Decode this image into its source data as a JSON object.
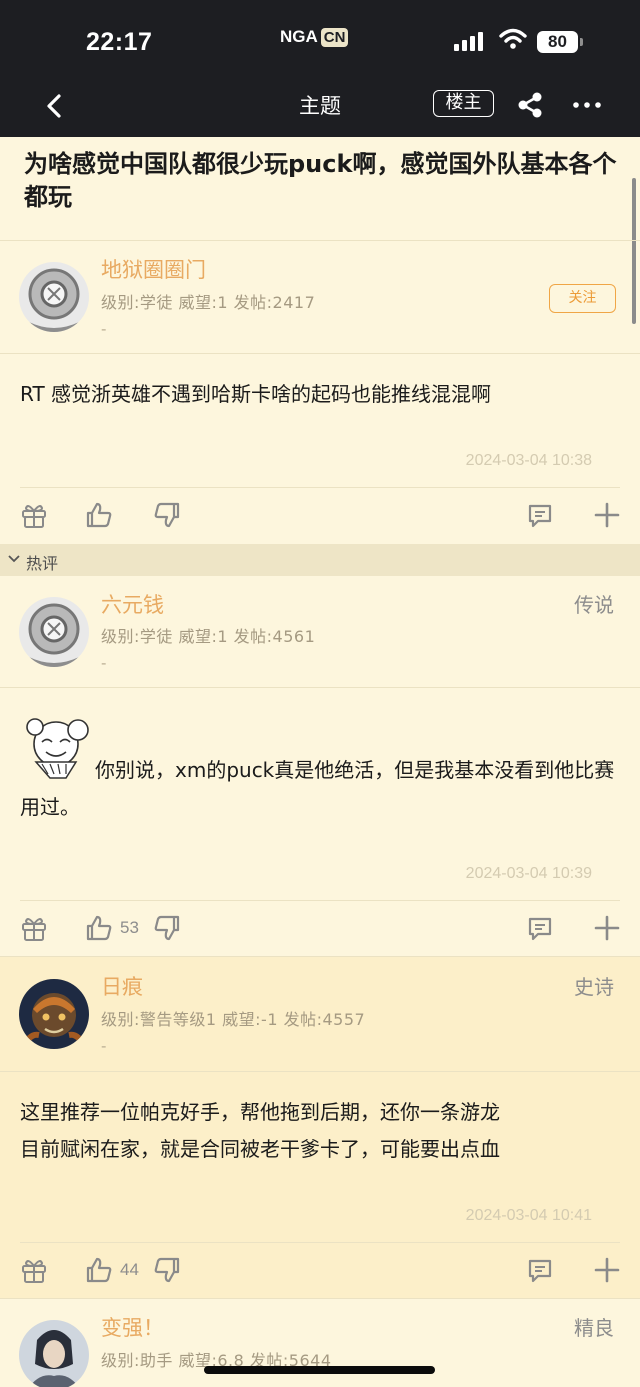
{
  "status_bar": {
    "time": "22:17",
    "brand": "NGA",
    "brand_suffix": "CN",
    "battery": "80"
  },
  "nav": {
    "title": "主题",
    "op_filter": "楼主"
  },
  "topic": {
    "title": "为啥感觉中国队都很少玩puck啊，感觉国外队基本各个都玩"
  },
  "main_post": {
    "author": "地狱圈圈门",
    "info": "级别:学徒   威望:1   发帖:2417",
    "sig": "-",
    "follow": "关注",
    "content": "RT 感觉浙英雄不遇到哈斯卡啥的起码也能推线混混啊",
    "time": "2024-03-04 10:38"
  },
  "hot_section": {
    "label": "热评"
  },
  "replies": [
    {
      "author": "六元钱",
      "rank": "传说",
      "info": "级别:学徒   威望:1   发帖:4561",
      "sig": "-",
      "content": "你别说，xm的puck真是他绝活，但是我基本没看到他比赛用过。",
      "time": "2024-03-04 10:39",
      "likes": "53"
    },
    {
      "author": "日痕",
      "rank": "史诗",
      "info": "级别:警告等级1   威望:-1   发帖:4557",
      "sig": "-",
      "content_line1": "这里推荐一位帕克好手，帮他拖到后期，还你一条游龙",
      "content_line2": "目前赋闲在家，就是合同被老干爹卡了，可能要出点血",
      "time": "2024-03-04 10:41",
      "likes": "44"
    },
    {
      "author": "变强！",
      "rank": "精良",
      "info": "级别:助手   威望:6.8   发帖:5644"
    }
  ],
  "icons": [
    "chevron-left-icon",
    "share-icon",
    "more-icon",
    "gift-icon",
    "thumb-up-icon",
    "thumb-down-icon",
    "comment-icon",
    "plus-icon",
    "chevron-down-icon"
  ],
  "colors": {
    "background": "#fdf6dd",
    "username": "#e8aa62",
    "header": "#1d1e22",
    "highlight_post": "#fcefc9"
  }
}
